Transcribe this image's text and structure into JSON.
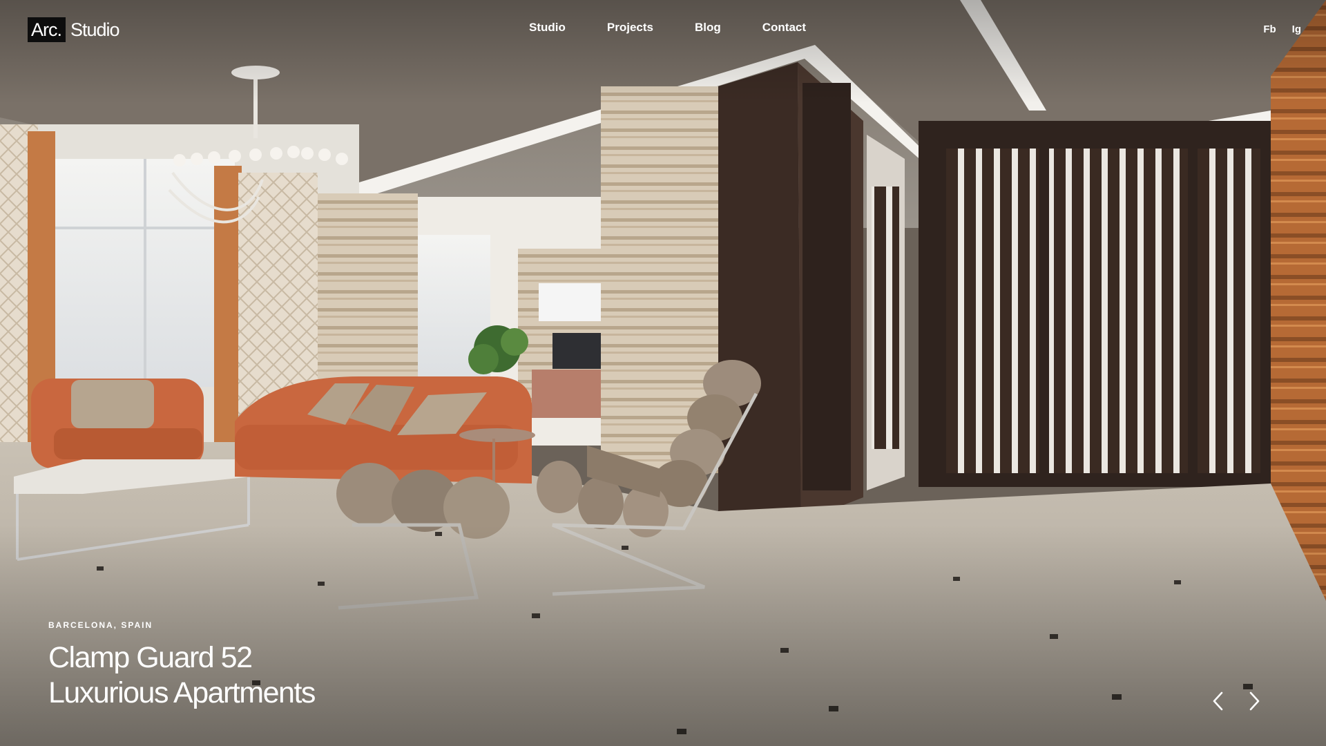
{
  "brand": {
    "logo_box": "Arc.",
    "logo_text": "Studio"
  },
  "nav": {
    "items": [
      "Studio",
      "Projects",
      "Blog",
      "Contact"
    ]
  },
  "social": {
    "items": [
      "Fb",
      "Ig"
    ]
  },
  "slide": {
    "location": "BARCELONA, SPAIN",
    "title_line1": "Clamp Guard 52",
    "title_line2": "Luxurious Apartments"
  },
  "colors": {
    "accent": "#ffffff",
    "logo_box": "#0d0d0d",
    "sofa": "#c9673f",
    "floor": "#cfc7ba"
  },
  "icons": {
    "prev": "chevron-left-icon",
    "next": "chevron-right-icon"
  }
}
